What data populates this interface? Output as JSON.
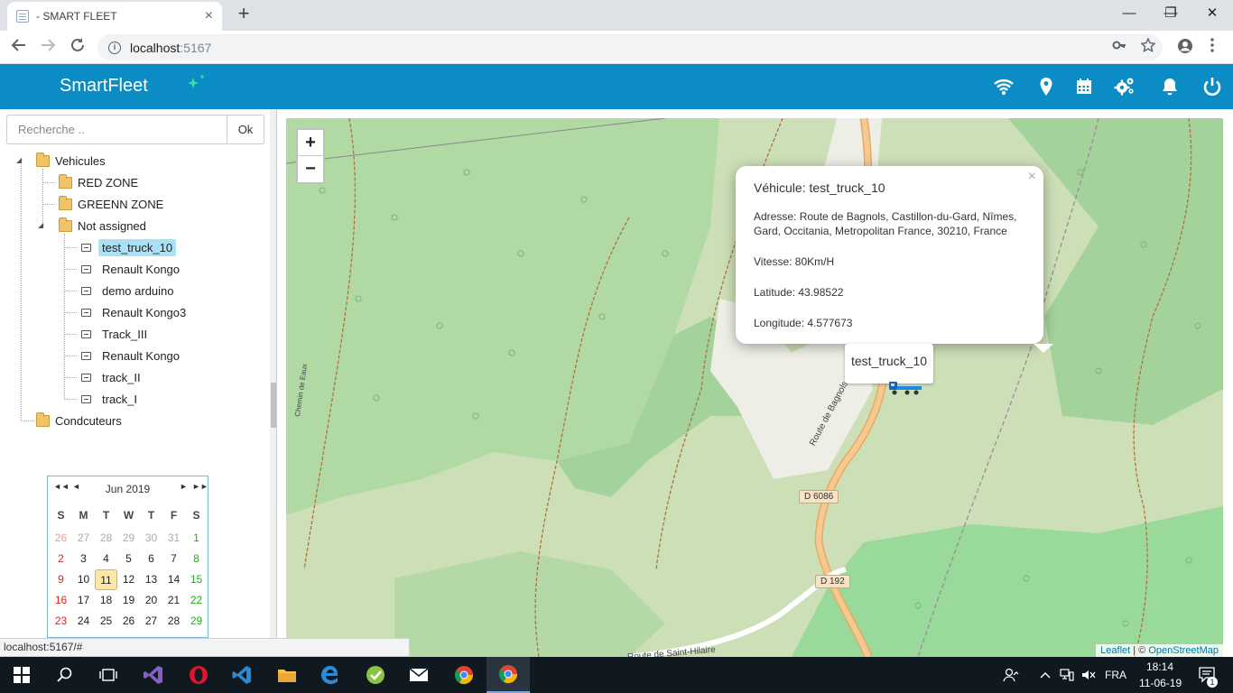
{
  "browser": {
    "tab_title": "- SMART FLEET",
    "tab_close": "×",
    "new_tab": "+",
    "win_minimize": "—",
    "win_restore": "❐",
    "win_close": "✕",
    "url_host": "localhost",
    "url_port": ":5167",
    "info_glyph": "i"
  },
  "header": {
    "brand": "SmartFleet",
    "icons": [
      "wifi-icon",
      "location-pin-icon",
      "calendar-icon",
      "gears-icon",
      "bell-icon",
      "power-icon"
    ],
    "accent_color": "#0c8cc4"
  },
  "sidebar": {
    "search_placeholder": "Recherche ..",
    "ok_label": "Ok",
    "tree": {
      "root_label": "Vehicules",
      "groups": [
        "RED ZONE",
        "GREENN ZONE",
        "Not assigned"
      ],
      "vehicles": [
        "test_truck_10",
        "Renault Kongo",
        "demo arduino",
        "Renault Kongo3",
        "Track_III",
        "Renault Kongo",
        "track_II",
        "track_I"
      ],
      "selected_vehicle": "test_truck_10",
      "drivers_label": "Condcuteurs"
    }
  },
  "calendar": {
    "month_label": "Jun 2019",
    "nav_prev_year": "◄◄",
    "nav_prev": "◄",
    "nav_next": "►",
    "nav_next_year": "►►",
    "weekdays": [
      "S",
      "M",
      "T",
      "W",
      "T",
      "F",
      "S"
    ],
    "weeks": [
      [
        "26",
        "27",
        "28",
        "29",
        "30",
        "31",
        "1"
      ],
      [
        "2",
        "3",
        "4",
        "5",
        "6",
        "7",
        "8"
      ],
      [
        "9",
        "10",
        "11",
        "12",
        "13",
        "14",
        "15"
      ],
      [
        "16",
        "17",
        "18",
        "19",
        "20",
        "21",
        "22"
      ],
      [
        "23",
        "24",
        "25",
        "26",
        "27",
        "28",
        "29"
      ]
    ],
    "today": "11"
  },
  "map": {
    "zoom_in": "+",
    "zoom_out": "−",
    "popup": {
      "close": "×",
      "title": "Véhicule: test_truck_10",
      "address": "Adresse: Route de Bagnols, Castillon-du-Gard, Nîmes, Gard, Occitania, Metropolitan France, 30210, France",
      "speed": "Vitesse: 80Km/H",
      "latitude": "Latitude: 43.98522",
      "longitude": "Longitude: 4.577673"
    },
    "marker_label": "test_truck_10",
    "road_labels": [
      "D 6086",
      "D 192",
      "Route de Bagnols",
      "Route de Saint-Hilaire",
      "Chemin de Eaux"
    ],
    "attribution": {
      "leaflet": "Leaflet",
      "sep": " | © ",
      "osm": "OpenStreetMap"
    }
  },
  "statusbar": {
    "url": "localhost:5167/#"
  },
  "taskbar": {
    "language": "FRA",
    "time": "18:14",
    "date": "11-06-19",
    "notification_count": "1"
  }
}
